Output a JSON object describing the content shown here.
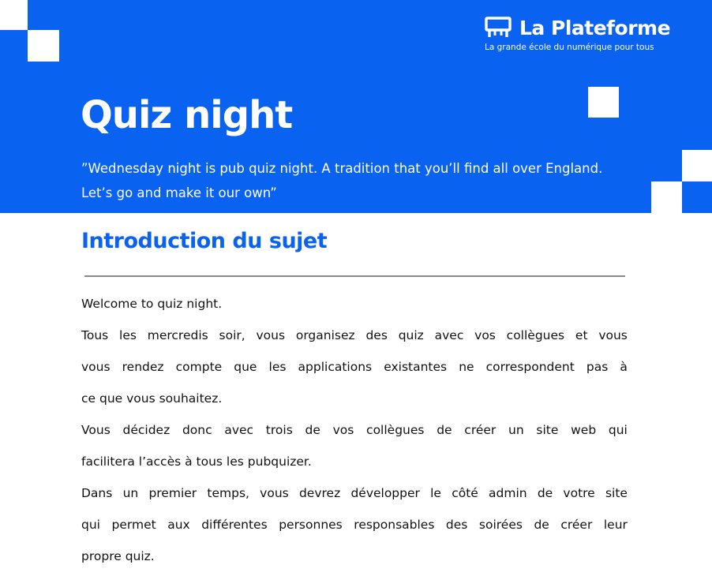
{
  "brand": {
    "logo_icon": "la-plateforme-logo-icon",
    "name": "La Plateforme",
    "tagline": "La grande école du numérique pour tous"
  },
  "header": {
    "title": "Quiz night",
    "quote_line_1": "”Wednesday night is pub quiz night. A tradition that you’ll find all over England.",
    "quote_line_2": "Let’s go and make it our own”"
  },
  "section": {
    "heading": "Introduction du sujet",
    "lines": [
      {
        "text": "Welcome to quiz night.",
        "justify": false
      },
      {
        "text": "Tous les mercredis soir, vous organisez des quiz avec vos collègues et vous",
        "justify": true
      },
      {
        "text": "vous rendez compte que les applications existantes ne correspondent pas à",
        "justify": true
      },
      {
        "text": "ce que vous souhaitez.",
        "justify": false
      },
      {
        "text": "Vous décidez donc avec trois de vos collègues de créer un site web qui",
        "justify": true
      },
      {
        "text": "facilitera l’accès à tous les pubquizer.",
        "justify": false
      },
      {
        "text": "Dans un premier temps, vous devrez développer le côté admin de votre site",
        "justify": true
      },
      {
        "text": "qui permet aux différentes personnes responsables des soirées de créer leur",
        "justify": true
      },
      {
        "text": "propre quiz.",
        "justify": false
      }
    ]
  },
  "colors": {
    "brand_blue": "#0a62f1",
    "text": "#111111",
    "rule": "#8a8a8a"
  }
}
